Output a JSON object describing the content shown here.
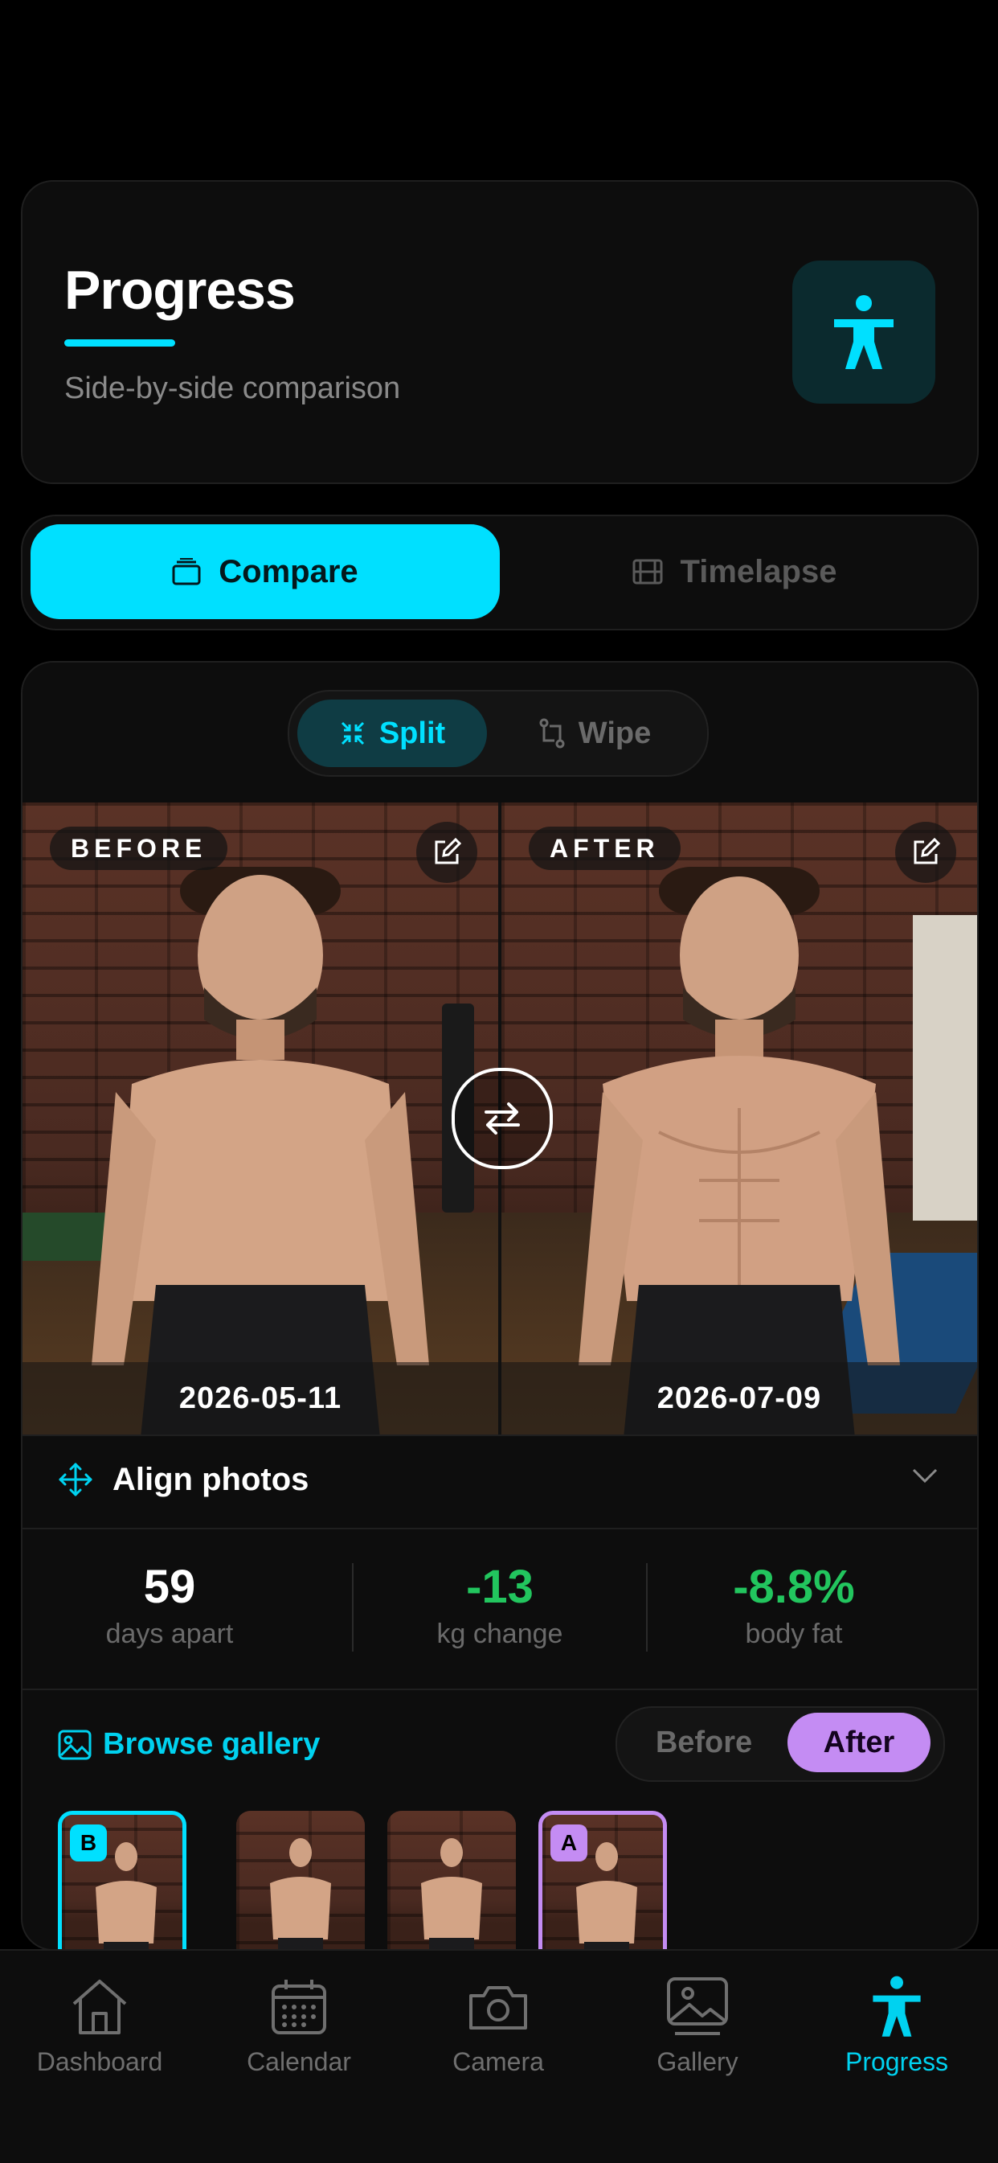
{
  "header": {
    "title": "Progress",
    "subtitle": "Side-by-side comparison",
    "icon": "accessibility-person-icon"
  },
  "mode_tabs": [
    {
      "label": "Compare",
      "icon": "layers-icon",
      "active": true
    },
    {
      "label": "Timelapse",
      "icon": "film-icon",
      "active": false
    }
  ],
  "view_toggle": [
    {
      "label": "Split",
      "icon": "collapse-arrows-icon",
      "active": true
    },
    {
      "label": "Wipe",
      "icon": "swap-path-icon",
      "active": false
    }
  ],
  "compare": {
    "before": {
      "tag": "BEFORE",
      "date": "2026-05-11"
    },
    "after": {
      "tag": "AFTER",
      "date": "2026-07-09"
    }
  },
  "align": {
    "label": "Align photos"
  },
  "stats": [
    {
      "value": "59",
      "label": "days apart",
      "color": "#ffffff"
    },
    {
      "value": "-13",
      "label": "kg change",
      "color": "#22c55e"
    },
    {
      "value": "-8.8%",
      "label": "body fat",
      "color": "#22c55e"
    }
  ],
  "gallery": {
    "link": "Browse gallery",
    "toggle": {
      "before": "Before",
      "after": "After",
      "active": "After"
    },
    "thumb_badges": {
      "b": "B",
      "a": "A"
    }
  },
  "nav": [
    {
      "label": "Dashboard",
      "icon": "home-icon"
    },
    {
      "label": "Calendar",
      "icon": "calendar-icon"
    },
    {
      "label": "Camera",
      "icon": "camera-icon"
    },
    {
      "label": "Gallery",
      "icon": "gallery-icon"
    },
    {
      "label": "Progress",
      "icon": "accessibility-person-icon",
      "active": true
    }
  ],
  "colors": {
    "accent": "#00e0ff",
    "after_accent": "#c48cf3",
    "positive": "#22c55e",
    "background": "#000000"
  }
}
